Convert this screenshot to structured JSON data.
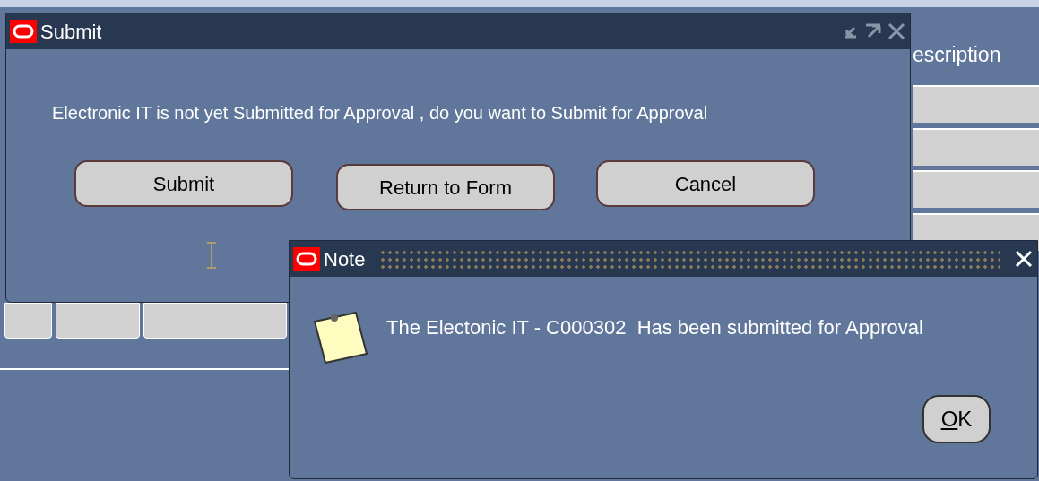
{
  "background_form": {
    "column_header": "escription"
  },
  "submit_dialog": {
    "title": "Submit",
    "message": "Electronic IT is not yet Submitted for Approval , do you want to Submit for Approval",
    "buttons": [
      "Submit",
      "Return to Form",
      "Cancel"
    ]
  },
  "note_dialog": {
    "title": "Note",
    "message": "The Electonic IT - C000302  Has been submitted for Approval",
    "button": "OK"
  }
}
